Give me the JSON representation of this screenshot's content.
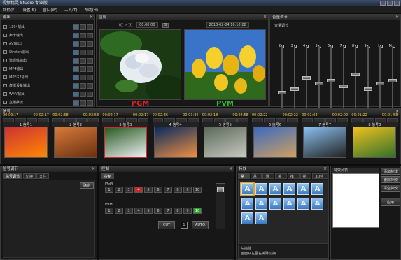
{
  "window": {
    "title": "视频精灵 Studio 专业版"
  },
  "menu": [
    "文件(F)",
    "设置(S)",
    "窗口(W)",
    "工具(T)",
    "帮助(H)"
  ],
  "output_panel": {
    "title": "输出",
    "items": [
      "1394输出",
      "声卡输出",
      "AVI输出",
      "Stretch输出",
      "流媒体输出",
      "MP4输出",
      "MPEG2输出",
      "虚拟设备输出",
      "WMV输出",
      "直播推流"
    ]
  },
  "monitor": {
    "title": "监视",
    "transport": "((( ⚪ )))",
    "timecode": "00:00:00",
    "date": "2013-02-04 16:10:28",
    "pgm_label": "PGM",
    "pvm_label": "PVM",
    "pgm_color": "#e02020",
    "pvm_color": "#20c020"
  },
  "audio": {
    "title": "音量调节",
    "channels": [
      "2",
      "3",
      "4",
      "5",
      "6",
      "7",
      "8",
      "9",
      "H",
      "M"
    ],
    "levels": [
      0.25,
      0.3,
      0.5,
      0.4,
      0.45,
      0.35,
      0.55,
      0.3,
      0.4,
      0.45
    ]
  },
  "cameras": {
    "title": "信号",
    "items": [
      {
        "name": "1 信号1",
        "tc_in": "00:00:17",
        "tc_out": "00:02:17",
        "colors": [
          "#c33",
          "#f80"
        ],
        "selected": false
      },
      {
        "name": "2 信号2",
        "tc_in": "00:02:58",
        "tc_out": "00:02:58",
        "colors": [
          "#d87a3a",
          "#6a3010"
        ],
        "selected": false
      },
      {
        "name": "3 信号3",
        "tc_in": "00:02:17",
        "tc_out": "00:02:17",
        "colors": [
          "#2a5a20",
          "#e8eef0"
        ],
        "selected": true
      },
      {
        "name": "4 信号4",
        "tc_in": "00:02:36",
        "tc_out": "00:03:36",
        "colors": [
          "#062a60",
          "#f09040"
        ],
        "selected": false
      },
      {
        "name": "5 信号5",
        "tc_in": "00:02:18",
        "tc_out": "00:02:58",
        "colors": [
          "#5a6a5a",
          "#c8c8c0"
        ],
        "selected": false
      },
      {
        "name": "6 信号6",
        "tc_in": "00:02:22",
        "tc_out": "00:02:22",
        "colors": [
          "#3a6ac0",
          "#d0a060"
        ],
        "selected": false
      },
      {
        "name": "7 信号7",
        "tc_in": "00:02:02",
        "tc_out": "00:02:02",
        "colors": [
          "#8ac0f0",
          "#222"
        ],
        "selected": false
      },
      {
        "name": "8 信号8",
        "tc_in": "00:01:22",
        "tc_out": "00:01:58",
        "colors": [
          "#f0c020",
          "#30702a"
        ],
        "selected": false
      }
    ]
  },
  "mix_panel": {
    "title": "信号调节",
    "tabs": [
      "信号调节",
      "切换",
      "文件"
    ],
    "button": "确定"
  },
  "switch_panel": {
    "title": "控制",
    "tab": "控制",
    "row1_label": "PGM",
    "row2_label": "PVM",
    "numbers": [
      "1",
      "2",
      "3",
      "4",
      "5",
      "6",
      "7",
      "8",
      "9",
      "10"
    ],
    "pgm_active": 3,
    "pvm_active": 9,
    "cut_label": "CUT",
    "auto_label": "AUTO",
    "mid_label": "1"
  },
  "effects_panel": {
    "title": "特效",
    "tabs": [
      "常用",
      "基本",
      "滑动",
      "擦除",
      "推拉",
      "卷页",
      "3D特效"
    ],
    "glyphs": [
      "A",
      "A",
      "A",
      "A",
      "A",
      "A",
      "A",
      "A",
      "A",
      "A",
      "A",
      "A",
      "A",
      "A"
    ],
    "selected": 0,
    "desc_title": "左擦除",
    "desc_text": "画面从左至右擦除切换"
  },
  "side_buttons": {
    "list_header": "特效列表",
    "b1": "添加特效",
    "b2": "删除特效",
    "b3": "清空特效",
    "b4": "应用"
  }
}
